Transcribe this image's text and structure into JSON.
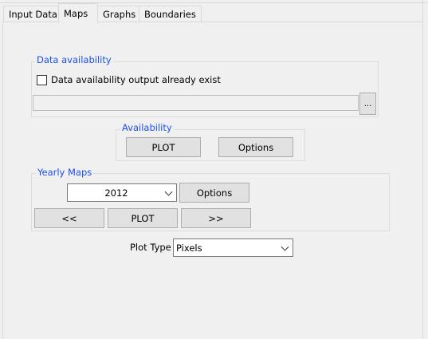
{
  "tabs": [
    {
      "label": "Input Data"
    },
    {
      "label": "Maps",
      "selected": true
    },
    {
      "label": "Graphs"
    },
    {
      "label": "Boundaries"
    }
  ],
  "data_availability": {
    "title": "Data availability",
    "checkbox_label": "Data availability output already exist",
    "checked": false,
    "path_value": "",
    "browse_label": "..."
  },
  "availability": {
    "title": "Availability",
    "plot_label": "PLOT",
    "options_label": "Options"
  },
  "yearly_maps": {
    "title": "Yearly Maps",
    "year_value": "2012",
    "options_label": "Options",
    "prev_label": "<<",
    "plot_label": "PLOT",
    "next_label": ">>"
  },
  "plot_type": {
    "label": "Plot Type",
    "value": "Pixels"
  }
}
